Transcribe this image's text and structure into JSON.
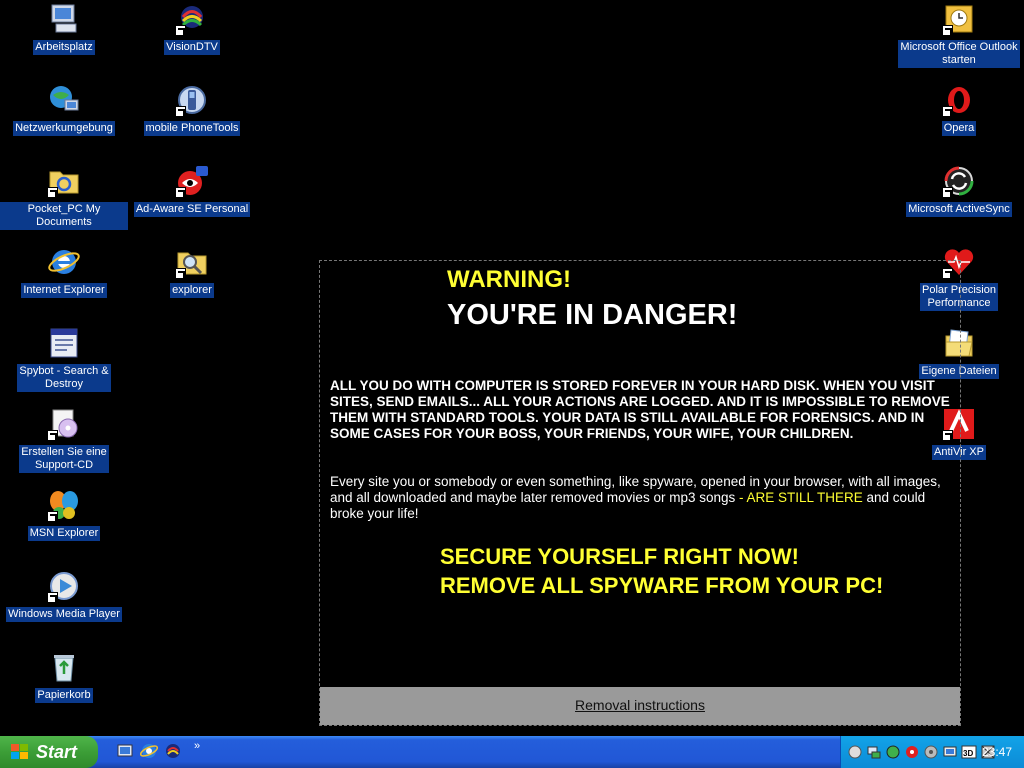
{
  "desktop_icons": {
    "arbeitsplatz": "Arbeitsplatz",
    "visiondtv": "VisionDTV",
    "netzwerk": "Netzwerkumgebung",
    "phonetools": "mobile PhoneTools",
    "pocketpc": "Pocket_PC My Documents",
    "adaware": "Ad-Aware SE Personal",
    "ie": "Internet Explorer",
    "explorer": "explorer",
    "spybot_line1": "Spybot - Search &",
    "spybot_line2": "Destroy",
    "support_line1": "Erstellen Sie eine",
    "support_line2": "Support-CD",
    "msn": "MSN Explorer",
    "wmp": "Windows Media Player",
    "papierkorb": "Papierkorb",
    "outlook_line1": "Microsoft Office Outlook",
    "outlook_line2": "starten",
    "opera": "Opera",
    "activesync": "Microsoft ActiveSync",
    "polar_line1": "Polar Precision",
    "polar_line2": "Performance",
    "eigene": "Eigene Dateien",
    "antivir": "AntiVir XP"
  },
  "warning": {
    "title1": "WARNING!",
    "title2": "YOU'RE IN DANGER!",
    "para1": "ALL YOU DO WITH COMPUTER IS STORED FOREVER IN YOUR HARD DISK. WHEN YOU VISIT SITES, SEND EMAILS... ALL YOUR ACTIONS ARE LOGGED. AND IT IS IMPOSSIBLE TO REMOVE THEM WITH STANDARD TOOLS. YOUR DATA IS STILL AVAILABLE FOR FORENSICS. AND IN SOME CASES FOR YOUR BOSS, YOUR FRIENDS, YOUR WIFE, YOUR CHILDREN.",
    "para2_a": "Every site you or somebody or even something, like spyware, opened in your browser, with all images, and all downloaded and maybe later removed movies or mp3 songs ",
    "para2_highlight": "- ARE STILL THERE",
    "para2_b": " and could broke your life!",
    "secure1": "SECURE YOURSELF RIGHT NOW!",
    "secure2": "REMOVE ALL SPYWARE FROM YOUR PC!",
    "removal_link": "Removal instructions"
  },
  "taskbar": {
    "start_label": "Start",
    "chevron": "»",
    "clock": "23:47"
  },
  "colors": {
    "label_bg": "#0b3a8c",
    "warning_yellow": "#ffff33",
    "taskbar_blue": "#245edb",
    "start_green": "#3c9e37"
  }
}
